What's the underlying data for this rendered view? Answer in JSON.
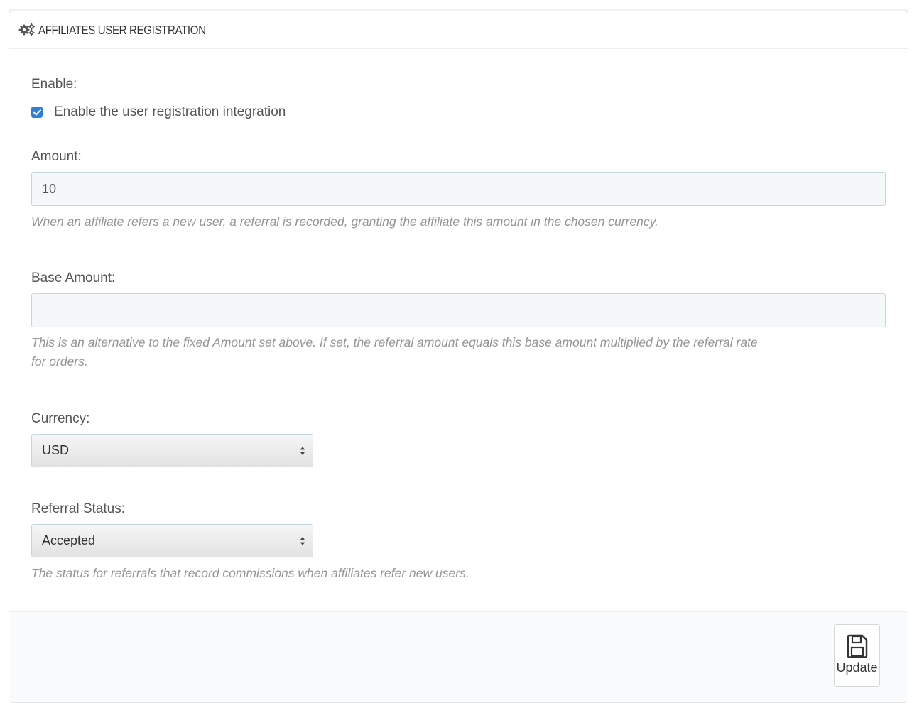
{
  "panel": {
    "title": "AFFILIATES USER REGISTRATION",
    "icon": "gears-icon"
  },
  "form": {
    "enable": {
      "label": "Enable:",
      "checkbox_label": "Enable the user registration integration",
      "checked": true
    },
    "amount": {
      "label": "Amount:",
      "value": "10",
      "help": "When an affiliate refers a new user, a referral is recorded, granting the affiliate this amount in the chosen currency."
    },
    "base_amount": {
      "label": "Base Amount:",
      "value": "",
      "help_line1": "This is an alternative to the fixed Amount set above. If set, the referral amount equals this base amount multiplied by the referral rate",
      "help_line2": "for orders."
    },
    "currency": {
      "label": "Currency:",
      "selected": "USD"
    },
    "referral_status": {
      "label": "Referral Status:",
      "selected": "Accepted",
      "help": "The status for referrals that record commissions when affiliates refer new users."
    }
  },
  "footer": {
    "update_label": "Update",
    "update_icon": "save-icon"
  },
  "colors": {
    "accent": "#2f7ed8",
    "help_text": "#959595",
    "input_bg": "#f5f8f9",
    "input_border": "#c7d6db"
  }
}
